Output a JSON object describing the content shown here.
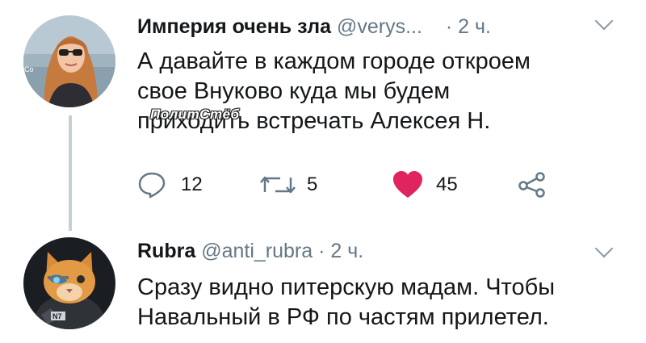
{
  "tweet1": {
    "display_name": "Империя очень зла",
    "handle": "@verys...",
    "time": "· 2 ч.",
    "text_lines": [
      "А давайте в каждом городе откроем",
      "свое Внуково куда мы будем",
      "приходить встречать Алексея Н."
    ],
    "watermark": "ПолитСтёб",
    "avatar_caption": "Co",
    "replies": "12",
    "retweets": "5",
    "likes": "45"
  },
  "tweet2": {
    "display_name": "Rubra",
    "handle": "@anti_rubra",
    "time": "· 2 ч.",
    "text_lines": [
      "Сразу видно питерскую мадам. Чтобы",
      "Навальный в РФ по частям прилетел."
    ],
    "avatar_badge": "N7"
  },
  "colors": {
    "like": "#e0245e",
    "icon": "#657786",
    "thread_line": "#c4cfd6"
  },
  "icons": [
    "reply-icon",
    "retweet-icon",
    "like-icon",
    "share-icon",
    "chevron-down-icon"
  ]
}
